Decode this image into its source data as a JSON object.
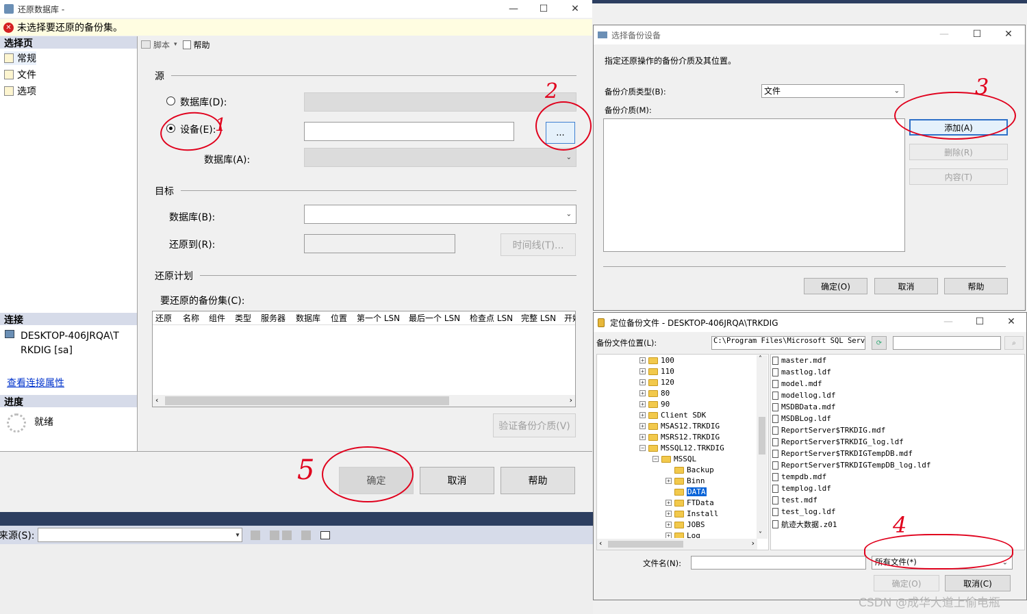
{
  "restore": {
    "title": "还原数据库 -",
    "error": "未选择要还原的备份集。",
    "select_page": "选择页",
    "pages": [
      "常规",
      "文件",
      "选项"
    ],
    "toolbar_script": "脚本",
    "toolbar_help": "帮助",
    "source": "源",
    "radio_database": "数据库(D):",
    "radio_device": "设备(E):",
    "browse": "...",
    "database_a": "数据库(A):",
    "target": "目标",
    "database_b": "数据库(B):",
    "restore_to": "还原到(R):",
    "timeline": "时间线(T)...",
    "restore_plan": "还原计划",
    "backup_sets": "要还原的备份集(C):",
    "columns": [
      "还原",
      "名称",
      "组件",
      "类型",
      "服务器",
      "数据库",
      "位置",
      "第一个 LSN",
      "最后一个 LSN",
      "检查点 LSN",
      "完整 LSN",
      "开始"
    ],
    "verify": "验证备份介质(V)",
    "connection": "连接",
    "server": "DESKTOP-406JRQA\\TRKDIG [sa]",
    "server_line1": "DESKTOP-406JRQA\\T",
    "server_line2": "RKDIG [sa]",
    "view_conn": "查看连接属性",
    "progress": "进度",
    "ready": "就绪",
    "ok": "确定",
    "cancel": "取消",
    "help": "帮助"
  },
  "bottom_bar": {
    "source_label": "来源(S):"
  },
  "select_device": {
    "title": "选择备份设备",
    "desc": "指定还原操作的备份介质及其位置。",
    "media_type_label": "备份介质类型(B):",
    "media_type_value": "文件",
    "media_label": "备份介质(M):",
    "add": "添加(A)",
    "remove": "删除(R)",
    "contents": "内容(T)",
    "ok": "确定(O)",
    "cancel": "取消",
    "help": "帮助"
  },
  "locate": {
    "title": "定位备份文件 - DESKTOP-406JRQA\\TRKDIG",
    "location_label": "备份文件位置(L):",
    "location_value": "C:\\Program Files\\Microsoft SQL Server",
    "tree": [
      "100",
      "110",
      "120",
      "80",
      "90",
      "Client SDK",
      "MSAS12.TRKDIG",
      "MSRS12.TRKDIG",
      "MSSQL12.TRKDIG",
      "MSSQL",
      "Backup",
      "Binn",
      "DATA",
      "FTData",
      "Install",
      "JOBS",
      "Log"
    ],
    "files": [
      "master.mdf",
      "mastlog.ldf",
      "model.mdf",
      "modellog.ldf",
      "MSDBData.mdf",
      "MSDBLog.ldf",
      "ReportServer$TRKDIG.mdf",
      "ReportServer$TRKDIG_log.ldf",
      "ReportServer$TRKDIGTempDB.mdf",
      "ReportServer$TRKDIGTempDB_log.ldf",
      "tempdb.mdf",
      "templog.ldf",
      "test.mdf",
      "test_log.ldf",
      "航迹大数据.z01"
    ],
    "filename_label": "文件名(N):",
    "filter": "所有文件(*)",
    "ok": "确定(O)",
    "cancel": "取消(C)"
  },
  "annotations": [
    "1",
    "2",
    "3",
    "4",
    "5"
  ],
  "watermark": "CSDN @成华大道上偷电瓶"
}
